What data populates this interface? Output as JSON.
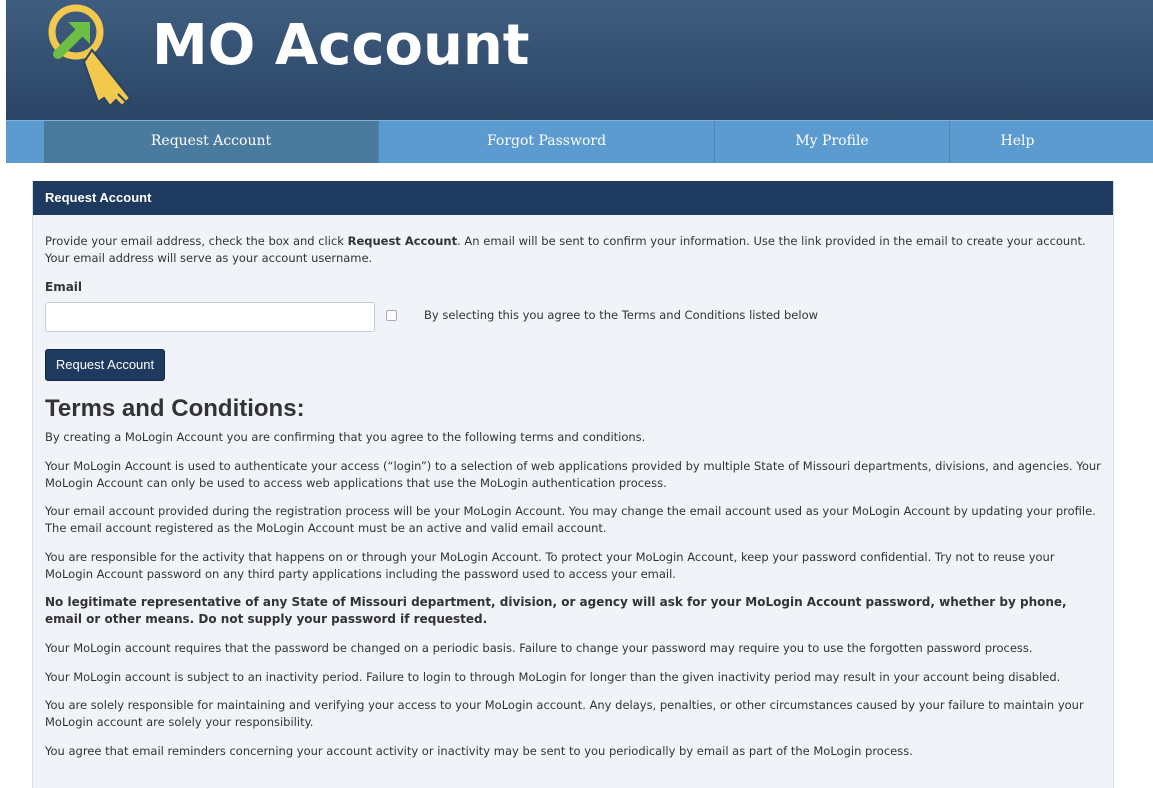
{
  "header": {
    "title": "MO Account",
    "logo_icon": "key-arrow-icon",
    "colors": {
      "header_bg": "#34506f",
      "accent_yellow": "#f2c94c",
      "accent_green": "#6dbe45"
    }
  },
  "nav": {
    "items": [
      {
        "label": "Request Account",
        "active": true
      },
      {
        "label": "Forgot Password",
        "active": false
      },
      {
        "label": "My Profile",
        "active": false
      },
      {
        "label": "Help",
        "active": false
      }
    ],
    "colors": {
      "bg": "#5b9bd0",
      "active_bg": "#4a7a9e"
    }
  },
  "panel": {
    "title": "Request Account",
    "intro_before": "Provide your email address, check the box and click ",
    "intro_bold": "Request Account",
    "intro_after": ". An email will be sent to confirm your information. Use the link provided in the email to create your account. Your email address will serve as your account username.",
    "email_label": "Email",
    "email_value": "",
    "checkbox_label": "By selecting this you agree to the Terms and Conditions listed below",
    "button_label": "Request Account"
  },
  "terms": {
    "title": "Terms and Conditions:",
    "paragraphs": [
      "By creating a MoLogin Account you are confirming that you agree to the following terms and conditions.",
      "Your MoLogin Account is used to authenticate your access (“login”) to a selection of web applications provided by multiple State of Missouri departments, divisions, and agencies. Your MoLogin Account can only be used to access web applications that use the MoLogin authentication process.",
      "Your email account provided during the registration process will be your MoLogin Account. You may change the email account used as your MoLogin Account by updating your profile. The email account registered as the MoLogin Account must be an active and valid email account.",
      "You are responsible for the activity that happens on or through your MoLogin Account. To protect your MoLogin Account, keep your password confidential. Try not to reuse your MoLogin Account password on any third party applications including the password used to access your email.",
      "No legitimate representative of any State of Missouri department, division, or agency will ask for your MoLogin Account password, whether by phone, email or other means. Do not supply your password if requested.",
      "Your MoLogin account requires that the password be changed on a periodic basis. Failure to change your password may require you to use the forgotten password process.",
      "Your MoLogin account is subject to an inactivity period. Failure to login to through MoLogin for longer than the given inactivity period may result in your account being disabled.",
      "You are solely responsible for maintaining and verifying your access to your MoLogin account. Any delays, penalties, or other circumstances caused by your failure to maintain your MoLogin account are solely your responsibility.",
      "You agree that email reminders concerning your account activity or inactivity may be sent to you periodically by email as part of the MoLogin process."
    ]
  }
}
